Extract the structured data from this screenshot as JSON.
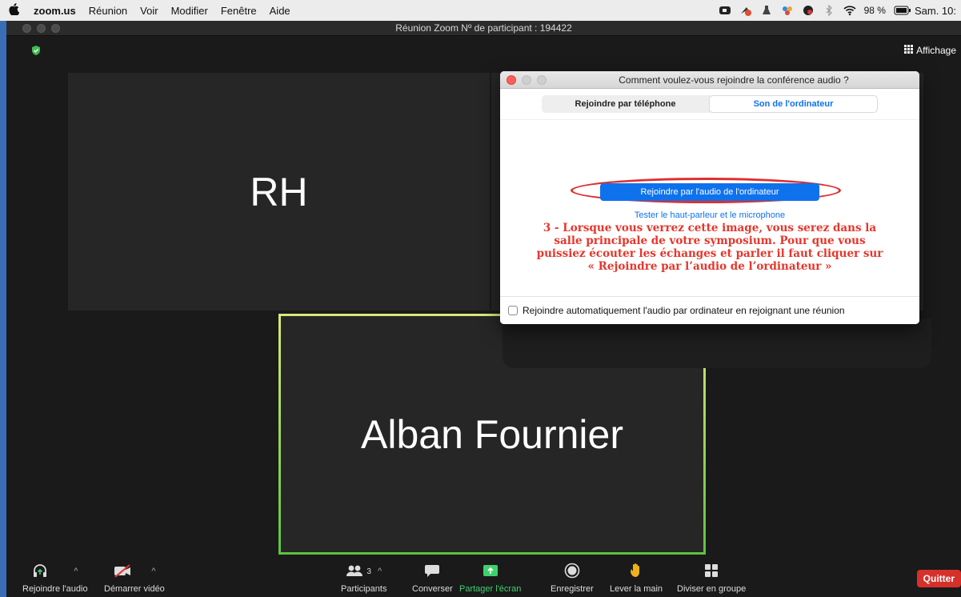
{
  "menubar": {
    "apple": "",
    "app": "zoom.us",
    "items": [
      "Réunion",
      "Voir",
      "Modifier",
      "Fenêtre",
      "Aide"
    ],
    "battery": "98 %",
    "clock": "Sam. 10:"
  },
  "window": {
    "title": "Réunion Zoom Nº de participant : 194422",
    "view_label": "Affichage"
  },
  "tiles": {
    "rh": "RH",
    "alban": "Alban Fournier"
  },
  "dialog": {
    "title": "Comment voulez-vous rejoindre la conférence audio ?",
    "tabs": [
      "Rejoindre par téléphone",
      "Son de l'ordinateur"
    ],
    "active_tab": 1,
    "join_button": "Rejoindre par l'audio de l'ordinateur",
    "test_link": "Tester le haut-parleur et le microphone",
    "annotation": "3 - Lorsque vous verrez cette image, vous serez dans la salle principale de votre symposium. Pour que vous puissiez écouter les échanges et parler il faut cliquer sur « Rejoindre par l’audio de l’ordinateur »",
    "auto_join_label": "Rejoindre automatiquement l'audio par ordinateur en rejoignant une réunion",
    "auto_join_checked": false
  },
  "toolbar": {
    "join_audio": "Rejoindre l'audio",
    "start_video": "Démarrer vidéo",
    "participants": "Participants",
    "participants_count": "3",
    "chat": "Converser",
    "share": "Partager l'écran",
    "record": "Enregistrer",
    "raise_hand": "Lever la main",
    "breakout": "Diviser en groupe",
    "quit": "Quitter"
  },
  "colors": {
    "accent": "#0e72ed",
    "annotation": "#e6362b",
    "share_green": "#3fd16c",
    "quit_red": "#d6302a"
  }
}
